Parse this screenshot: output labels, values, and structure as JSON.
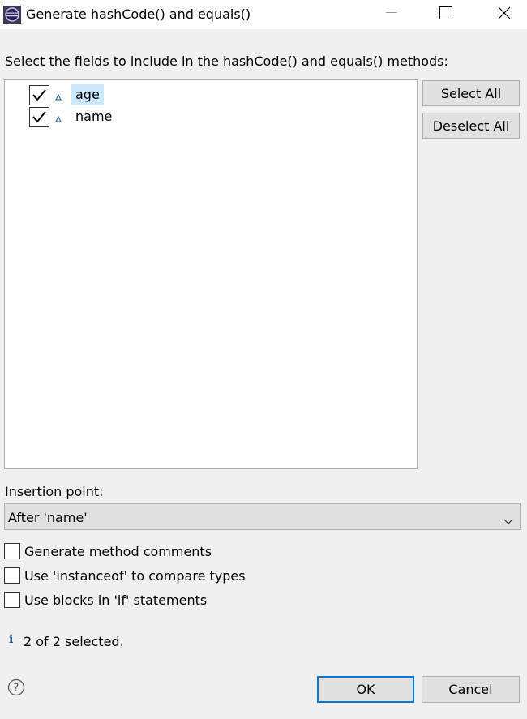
{
  "window": {
    "title": "Generate hashCode() and equals()",
    "icon": "eclipse-icon"
  },
  "prompt": "Select the fields to include in the hashCode() and equals() methods:",
  "fields": [
    {
      "label": "age",
      "checked": true,
      "selected": true,
      "icon": "field-default-visibility-icon"
    },
    {
      "label": "name",
      "checked": true,
      "selected": false,
      "icon": "field-default-visibility-icon"
    }
  ],
  "buttons": {
    "select_all": "Select All",
    "deselect_all": "Deselect All",
    "ok": "OK",
    "cancel": "Cancel"
  },
  "insertion": {
    "label": "Insertion point:",
    "value": "After 'name'"
  },
  "options": [
    {
      "label": "Generate method comments",
      "checked": false
    },
    {
      "label": "Use 'instanceof' to compare types",
      "checked": false
    },
    {
      "label": "Use blocks in 'if' statements",
      "checked": false
    }
  ],
  "status": {
    "icon": "info-icon",
    "text": "2 of 2 selected."
  },
  "colors": {
    "background": "#f0f0f0",
    "selection": "#cce8ff",
    "default_button_border": "#0078d7"
  }
}
